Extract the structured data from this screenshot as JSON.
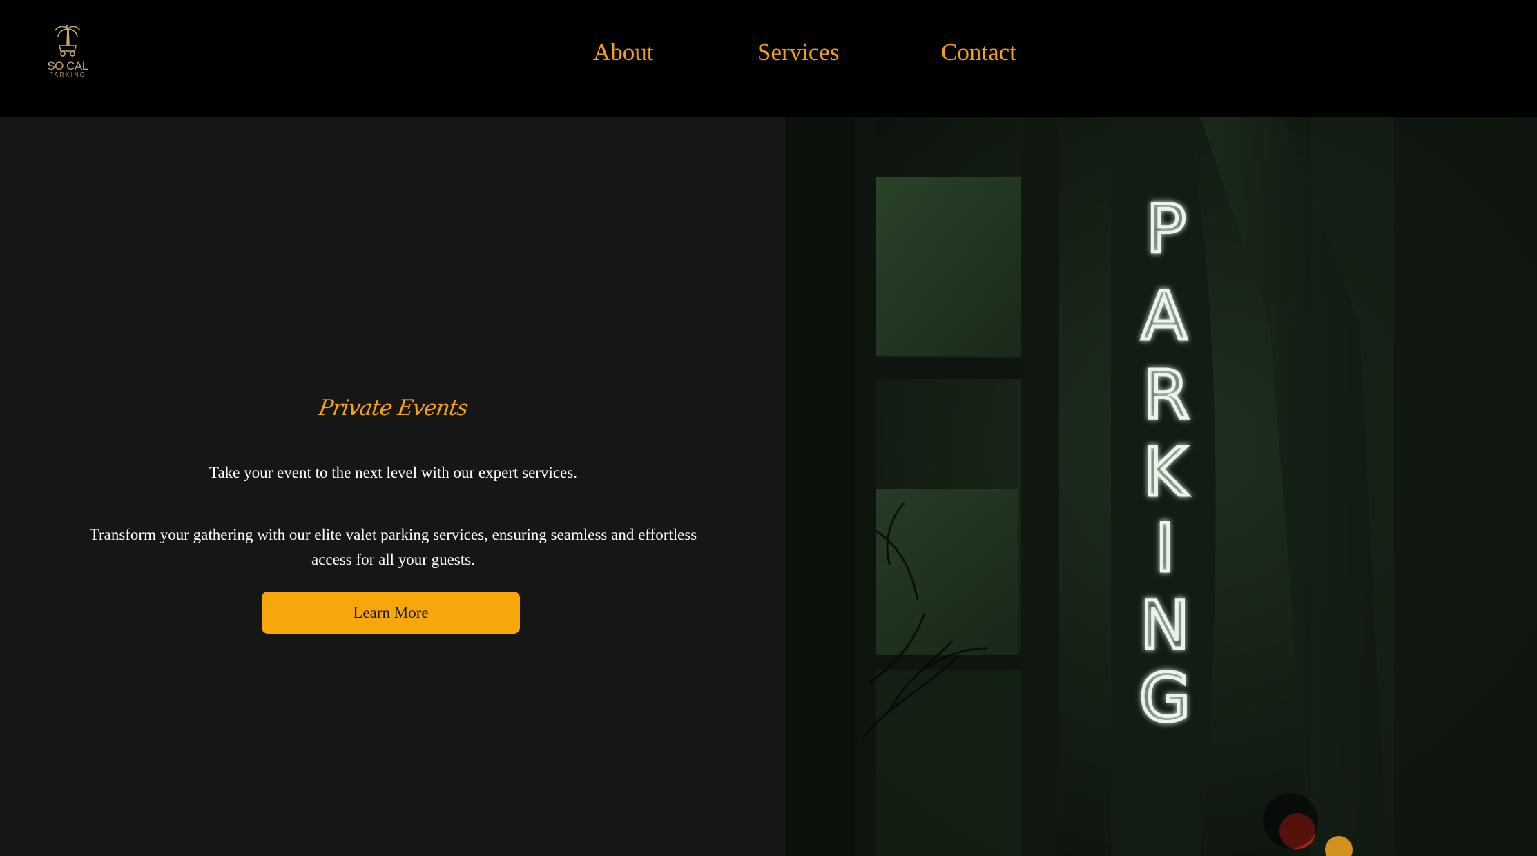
{
  "header": {
    "logo": {
      "name": "SO CAL",
      "tagline": "PARKING"
    },
    "nav": [
      {
        "label": "About"
      },
      {
        "label": "Services"
      },
      {
        "label": "Contact"
      }
    ]
  },
  "hero": {
    "eyebrow": "Private Events",
    "subtitle": "Take your event to the next level with our expert services.",
    "body": "Transform your gathering with our elite valet parking services, ensuring seamless and effortless access for all your guests.",
    "cta_label": "Learn More"
  },
  "photo": {
    "sign_letters": [
      "P",
      "A",
      "R",
      "K",
      "I",
      "N",
      "G"
    ]
  },
  "colors": {
    "accent": "#f5a30d",
    "button": "#f8a70b",
    "panel": "#161616",
    "header": "#000000"
  }
}
